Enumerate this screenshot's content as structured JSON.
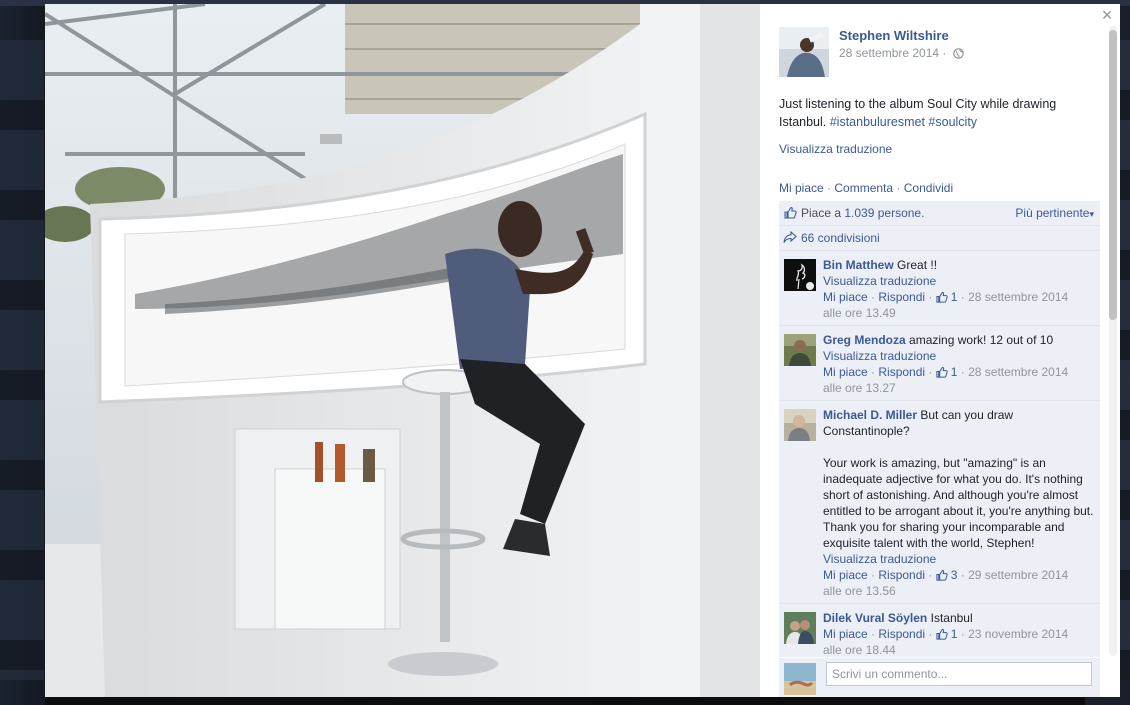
{
  "post": {
    "author": "Stephen Wiltshire",
    "date": "28 settembre 2014 ·",
    "text_prefix": "Just listening to the album Soul City while drawing Istanbul. ",
    "hashtag1": "#istanbuluresmet",
    "hashtag2": "#soulcity",
    "translate_label": "Visualizza traduzione",
    "privacy_icon": "globe-icon"
  },
  "actions": {
    "like": "Mi piace",
    "comment": "Commenta",
    "share": "Condividi",
    "separator": "·"
  },
  "likes": {
    "prefix": "Piace a ",
    "count": "1.039 persone.",
    "sort_label": "Più pertinente"
  },
  "shares": {
    "label": "66 condivisioni"
  },
  "comments": [
    {
      "name": "Bin Matthew",
      "text": "Great !!",
      "translate": "Visualizza traduzione",
      "like": "Mi piace",
      "reply": "Rispondi",
      "likes": "1",
      "date": "· 28 settembre 2014",
      "time": "alle ore 13.49"
    },
    {
      "name": "Greg Mendoza",
      "text": "amazing work! 12 out of 10",
      "translate": "Visualizza traduzione",
      "like": "Mi piace",
      "reply": "Rispondi",
      "likes": "1",
      "date": "· 28 settembre 2014",
      "time": "alle ore 13.27"
    },
    {
      "name": "Michael D. Miller",
      "text": "But can you draw Constantinople?",
      "text2": "Your work is amazing, but \"amazing\" is an inadequate adjective for what you do. It's nothing short of astonishing. And although you're almost entitled to be arrogant about it, you're anything but. Thank you for sharing your incomparable and exquisite talent with the world, Stephen!",
      "translate": "Visualizza traduzione",
      "like": "Mi piace",
      "reply": "Rispondi",
      "likes": "3",
      "date": "· 29 settembre 2014",
      "time": "alle ore 13.56"
    },
    {
      "name": "Dilek Vural Söylen",
      "text": "Istanbul",
      "like": "Mi piace",
      "reply": "Rispondi",
      "likes": "1",
      "date": "· 23 novembre 2014",
      "time": "alle ore 18.44"
    }
  ],
  "composer": {
    "placeholder": "Scrivi un commento..."
  },
  "icons": {
    "close": "×",
    "sort_caret": "▾"
  },
  "colors": {
    "link": "#3b5998",
    "meta": "#90949c",
    "comment_bg": "#eceff5"
  }
}
